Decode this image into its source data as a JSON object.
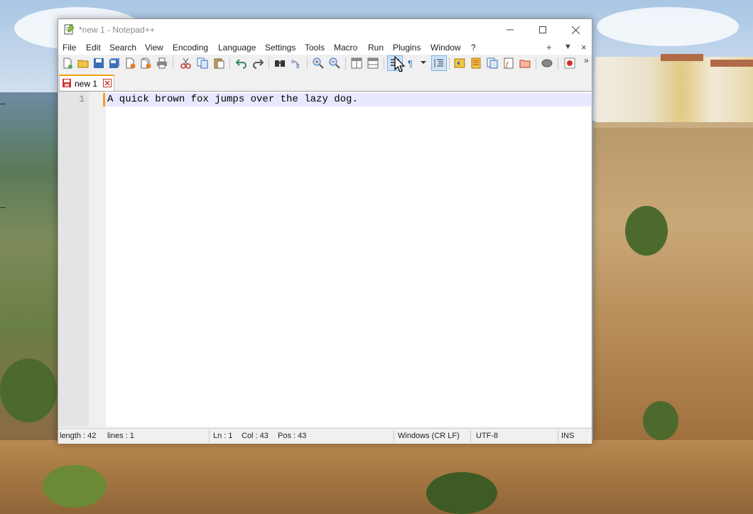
{
  "window": {
    "title": "*new 1 - Notepad++"
  },
  "menu": [
    "File",
    "Edit",
    "Search",
    "View",
    "Encoding",
    "Language",
    "Settings",
    "Tools",
    "Macro",
    "Run",
    "Plugins",
    "Window",
    "?"
  ],
  "menu_right": {
    "add": "+",
    "dropdown": "▼",
    "close": "×"
  },
  "toolbar": {
    "overflow": "»",
    "icons": [
      "new-file-icon",
      "open-file-icon",
      "save-icon",
      "save-all-icon",
      "close-icon",
      "close-all-icon",
      "print-icon",
      "cut-icon",
      "copy-icon",
      "paste-icon",
      "undo-icon",
      "redo-icon",
      "find-icon",
      "replace-icon",
      "zoom-in-icon",
      "zoom-out-icon",
      "sync-vertical-icon",
      "sync-horizontal-icon",
      "word-wrap-icon",
      "show-all-chars-icon",
      "indent-guide-icon",
      "user-language-icon",
      "doc-map-icon",
      "doc-list-icon",
      "function-list-icon",
      "folder-workspace-icon",
      "monitoring-icon",
      "record-macro-icon"
    ]
  },
  "tabs": [
    {
      "label": "new 1"
    }
  ],
  "editor": {
    "line_numbers": [
      "1"
    ],
    "lines": [
      "A quick brown fox jumps over the lazy dog."
    ]
  },
  "status": {
    "length": "length : 42",
    "lines": "lines : 1",
    "ln": "Ln : 1",
    "col": "Col : 43",
    "pos": "Pos : 43",
    "eol": "Windows (CR LF)",
    "encoding": "UTF-8",
    "mode": "INS"
  },
  "colors": {
    "accent": "#f3a000",
    "current_line": "#e8e8ff",
    "active_button": "#cce4f7"
  }
}
